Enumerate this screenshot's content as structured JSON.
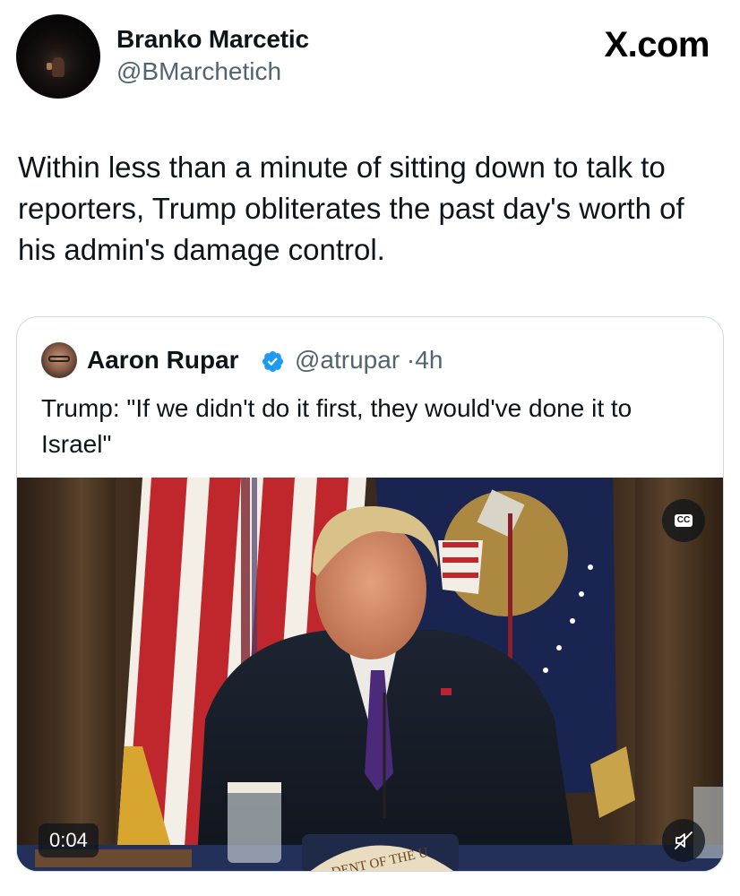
{
  "post": {
    "author": {
      "name": "Branko Marcetic",
      "handle": "@BMarchetich"
    },
    "brand": "X.com",
    "text": "Within less than a minute of sitting down to talk to reporters, Trump obliterates the past day's worth of his admin's damage control."
  },
  "quote": {
    "author": {
      "name": "Aaron Rupar",
      "handle": "@atrupar",
      "separator": "·",
      "time": "4h",
      "verified": true
    },
    "text": "Trump: \"If we didn't do it first, they would've done it to Israel\"",
    "video": {
      "duration": "0:04",
      "cc_label": "CC",
      "seal_text": "DENT OF THE U",
      "muted": true
    }
  },
  "colors": {
    "text": "#0f1419",
    "secondary": "#536471",
    "border": "#cfd9de",
    "verified": "#1d9bf0"
  },
  "icons": [
    "verified-badge-icon",
    "closed-captions-icon",
    "muted-speaker-icon"
  ]
}
